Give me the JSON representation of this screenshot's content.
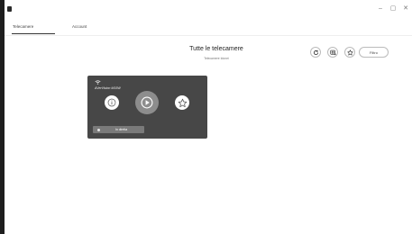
{
  "window": {
    "controls": {
      "minimize": "–",
      "maximize": "▢",
      "close": "✕"
    }
  },
  "tabs": [
    {
      "label": "Telecamere",
      "active": true
    },
    {
      "label": "Account",
      "active": false
    }
  ],
  "main": {
    "title": "Tutte le telecamere",
    "subtitle": "Telecamere Idonei"
  },
  "toolbar": {
    "filter_label": "Filtro",
    "icons": [
      "refresh-icon",
      "add-camera-icon",
      "favorite-icon"
    ]
  },
  "camera_card": {
    "name": "AVerVision M15W",
    "live_label": "In diretta",
    "icons": [
      "wifi-icon",
      "info-icon",
      "play-icon",
      "star-icon"
    ]
  },
  "colors": {
    "card_bg": "#474747",
    "play_button": "#8d8d8d",
    "live_bar": "#7a7a7a"
  }
}
